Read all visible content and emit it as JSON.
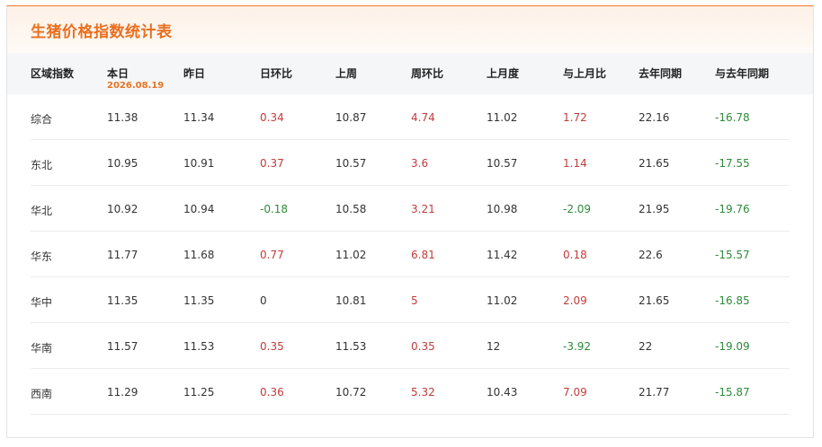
{
  "title": "生猪价格指数统计表",
  "columns": [
    {
      "label": "区域指数",
      "sub": ""
    },
    {
      "label": "本日",
      "sub": "2026.08.19"
    },
    {
      "label": "昨日",
      "sub": ""
    },
    {
      "label": "日环比",
      "sub": ""
    },
    {
      "label": "上周",
      "sub": ""
    },
    {
      "label": "周环比",
      "sub": ""
    },
    {
      "label": "上月度",
      "sub": ""
    },
    {
      "label": "与上月比",
      "sub": ""
    },
    {
      "label": "去年同期",
      "sub": ""
    },
    {
      "label": "与去年同期",
      "sub": ""
    }
  ],
  "colors": {
    "accent": "#ea6f1e",
    "positive": "#c33b3b",
    "negative": "#2e8b3a"
  },
  "rows": [
    {
      "region": "综合",
      "today": "11.38",
      "yesterday": "11.34",
      "day_change": "0.34",
      "last_week": "10.87",
      "week_change": "4.74",
      "last_month": "11.02",
      "month_change": "1.72",
      "last_year": "22.16",
      "year_change": "-16.78"
    },
    {
      "region": "东北",
      "today": "10.95",
      "yesterday": "10.91",
      "day_change": "0.37",
      "last_week": "10.57",
      "week_change": "3.6",
      "last_month": "10.57",
      "month_change": "1.14",
      "last_year": "21.65",
      "year_change": "-17.55"
    },
    {
      "region": "华北",
      "today": "10.92",
      "yesterday": "10.94",
      "day_change": "-0.18",
      "last_week": "10.58",
      "week_change": "3.21",
      "last_month": "10.98",
      "month_change": "-2.09",
      "last_year": "21.95",
      "year_change": "-19.76"
    },
    {
      "region": "华东",
      "today": "11.77",
      "yesterday": "11.68",
      "day_change": "0.77",
      "last_week": "11.02",
      "week_change": "6.81",
      "last_month": "11.42",
      "month_change": "0.18",
      "last_year": "22.6",
      "year_change": "-15.57"
    },
    {
      "region": "华中",
      "today": "11.35",
      "yesterday": "11.35",
      "day_change": "0",
      "last_week": "10.81",
      "week_change": "5",
      "last_month": "11.02",
      "month_change": "2.09",
      "last_year": "21.65",
      "year_change": "-16.85"
    },
    {
      "region": "华南",
      "today": "11.57",
      "yesterday": "11.53",
      "day_change": "0.35",
      "last_week": "11.53",
      "week_change": "0.35",
      "last_month": "12",
      "month_change": "-3.92",
      "last_year": "22",
      "year_change": "-19.09"
    },
    {
      "region": "西南",
      "today": "11.29",
      "yesterday": "11.25",
      "day_change": "0.36",
      "last_week": "10.72",
      "week_change": "5.32",
      "last_month": "10.43",
      "month_change": "7.09",
      "last_year": "21.77",
      "year_change": "-15.87"
    }
  ]
}
